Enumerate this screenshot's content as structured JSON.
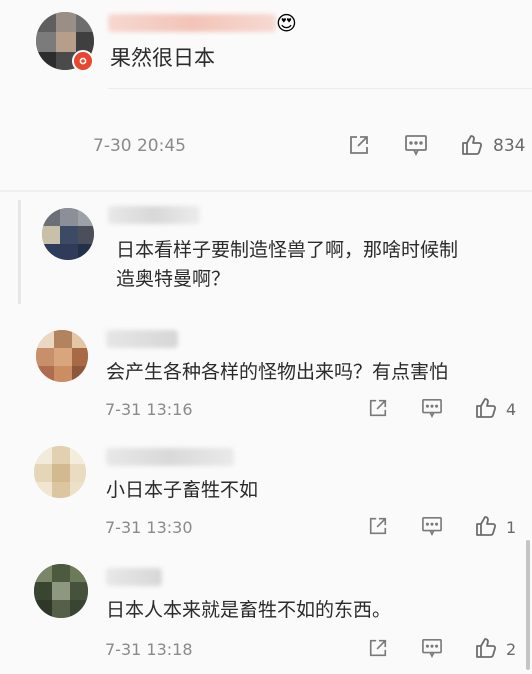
{
  "comments": [
    {
      "text": "果然很日本",
      "time": "7-30 20:45",
      "likes": "834",
      "emoji": "😍"
    },
    {
      "text": "日本看样子要制造怪兽了啊，那啥时候制造奥特曼啊？"
    },
    {
      "text": "会产生各种各样的怪物出来吗？有点害怕",
      "time": "7-31 13:16",
      "likes": "4"
    },
    {
      "text": "小日本子畜牲不如",
      "time": "7-31 13:30",
      "likes": "1"
    },
    {
      "text": "日本人本来就是畜牲不如的东西。",
      "time": "7-31 13:18",
      "likes": "2"
    }
  ],
  "icons": {
    "share": "share-icon",
    "reply": "comment-icon",
    "like": "thumbs-up-icon"
  },
  "colors": {
    "badge": "#e8462f",
    "text": "#2b2b2b",
    "meta": "#8a8a8a"
  }
}
